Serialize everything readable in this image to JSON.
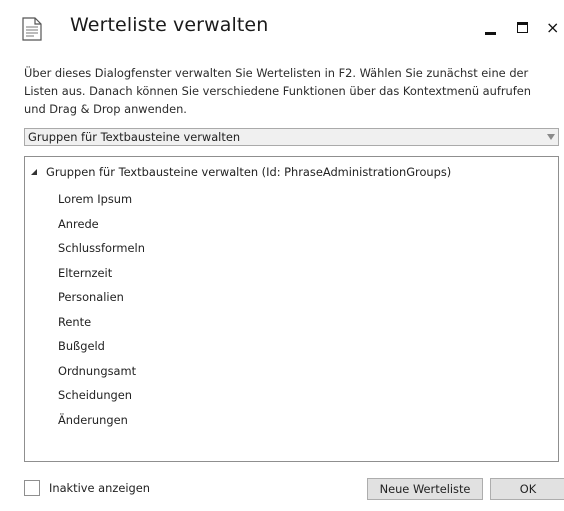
{
  "window": {
    "title": "Werteliste verwalten",
    "icon": "document-icon",
    "controls": {
      "minimize": "minimize-icon",
      "maximize": "maximize-icon",
      "close": "×"
    }
  },
  "description": "Über dieses Dialogfenster verwalten Sie Wertelisten in F2. Wählen Sie zunächst eine der Listen aus. Danach können Sie verschiedene Funktionen über das Kontextmenü aufrufen und Drag & Drop anwenden.",
  "list_selector": {
    "selected": "Gruppen für Textbausteine verwalten"
  },
  "tree": {
    "root": "Gruppen für Textbausteine verwalten (Id: PhraseAdministrationGroups)",
    "items": [
      "Lorem Ipsum",
      "Anrede",
      "Schlussformeln",
      "Elternzeit",
      "Personalien",
      "Rente",
      "Bußgeld",
      "Ordnungsamt",
      "Scheidungen",
      "Änderungen"
    ]
  },
  "footer": {
    "inactive_label": "Inaktive anzeigen",
    "inactive_checked": false,
    "new_list_label": "Neue Werteliste",
    "ok_label": "OK"
  }
}
